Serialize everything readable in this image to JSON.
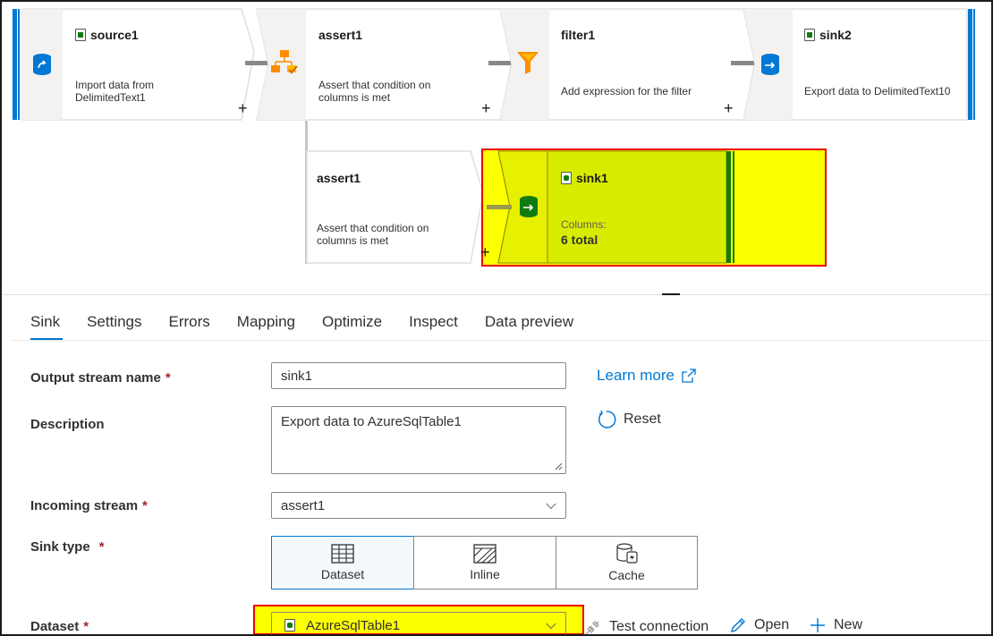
{
  "flow": {
    "source1": {
      "title": "source1",
      "desc_line1": "Import data from",
      "desc_line2": "DelimitedText1"
    },
    "assert1_top": {
      "title": "assert1",
      "desc_line1": "Assert that condition on",
      "desc_line2": "columns is met"
    },
    "filter1": {
      "title": "filter1",
      "desc_line1": "Add expression for the filter"
    },
    "sink2": {
      "title": "sink2",
      "desc_line1": "Export data to DelimitedText10"
    },
    "assert1_bottom": {
      "title": "assert1",
      "desc_line1": "Assert that condition on",
      "desc_line2": "columns is met"
    },
    "sink1": {
      "title": "sink1",
      "columns_label": "Columns:",
      "columns_value": "6 total"
    },
    "plus": "+"
  },
  "tabs": [
    "Sink",
    "Settings",
    "Errors",
    "Mapping",
    "Optimize",
    "Inspect",
    "Data preview"
  ],
  "form": {
    "output_stream_label": "Output stream name",
    "output_stream_value": "sink1",
    "description_label": "Description",
    "description_value": "Export data to AzureSqlTable1",
    "incoming_stream_label": "Incoming stream",
    "incoming_stream_value": "assert1",
    "sink_type_label": "Sink type",
    "sink_types": [
      "Dataset",
      "Inline",
      "Cache"
    ],
    "sink_type_selected": "Dataset",
    "dataset_label": "Dataset",
    "dataset_value": "AzureSqlTable1",
    "required_mark": "*",
    "learn_more": "Learn more",
    "reset": "Reset",
    "test_connection": "Test connection",
    "open": "Open",
    "new": "New"
  },
  "colors": {
    "accent": "#0078d4",
    "highlight": "#fbff00",
    "highlight_border": "#e00000",
    "sink_green": "#107c10"
  }
}
